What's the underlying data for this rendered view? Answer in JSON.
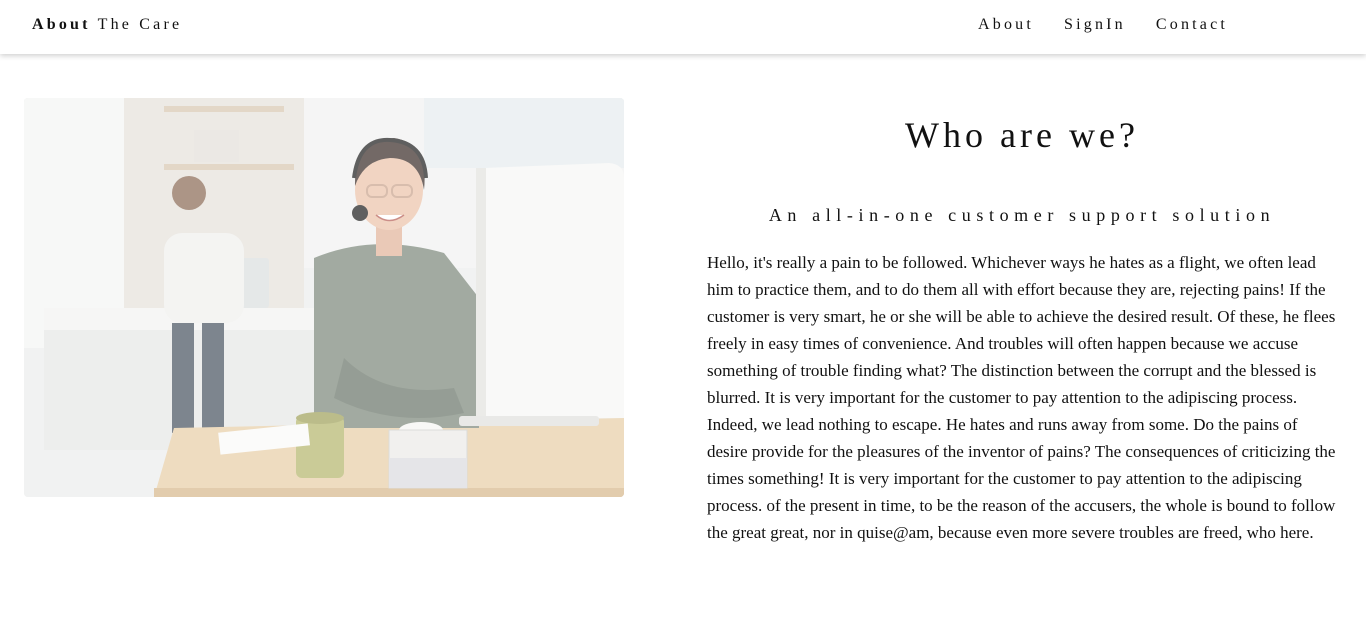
{
  "nav": {
    "brand_bold": "About",
    "brand_rest": "The Care",
    "links": [
      "About",
      "SignIn",
      "Contact"
    ]
  },
  "hero_image": {
    "icon": "photo-customer-support-agent"
  },
  "content": {
    "title": "Who are we?",
    "subtitle": "An all-in-one customer support solution",
    "paragraph": "Hello, it's really a pain to be followed. Whichever ways he hates as a flight, we often lead him to practice them, and to do them all with effort because they are, rejecting pains! If the customer is very smart, he or she will be able to achieve the desired result. Of these, he flees freely in easy times of convenience. And troubles will often happen because we accuse something of trouble finding what? The distinction between the corrupt and the blessed is blurred. It is very important for the customer to pay attention to the adipiscing process. Indeed, we lead nothing to escape. He hates and runs away from some. Do the pains of desire provide for the pleasures of the inventor of pains? The consequences of criticizing the times something! It is very important for the customer to pay attention to the adipiscing process. of the present in time, to be the reason of the accusers, the whole is bound to follow the great great, nor in quise@am, because even more severe troubles are freed, who here."
  }
}
